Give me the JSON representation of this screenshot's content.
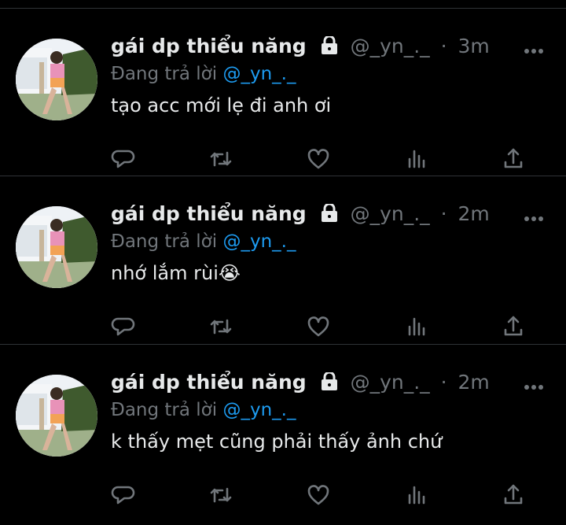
{
  "tweets": [
    {
      "name": "gái dp thiểu năng",
      "handle": "@_yn_._",
      "separator": "·",
      "time": "3m",
      "replying_prefix": "Đang trả lời",
      "replying_to": "@_yn_._",
      "text": "tạo acc mới lẹ đi anh ơi"
    },
    {
      "name": "gái dp thiểu năng",
      "handle": "@_yn_._",
      "separator": "·",
      "time": "2m",
      "replying_prefix": "Đang trả lời",
      "replying_to": "@_yn_._",
      "text": "nhớ lắm rùi",
      "emoji": "😭"
    },
    {
      "name": "gái dp thiểu năng",
      "handle": "@_yn_._",
      "separator": "·",
      "time": "2m",
      "replying_prefix": "Đang trả lời",
      "replying_to": "@_yn_._",
      "text": "k thấy mẹt cũng phải thấy ảnh chứ"
    }
  ],
  "icons": {
    "lock": "lock-icon",
    "more": "more-icon",
    "reply": "reply-icon",
    "retweet": "retweet-icon",
    "like": "heart-icon",
    "views": "views-icon",
    "share": "share-icon"
  },
  "colors": {
    "background": "#000000",
    "text": "#e7e9ea",
    "secondary": "#71767b",
    "link": "#1d9bf0",
    "divider": "#2f3336"
  }
}
